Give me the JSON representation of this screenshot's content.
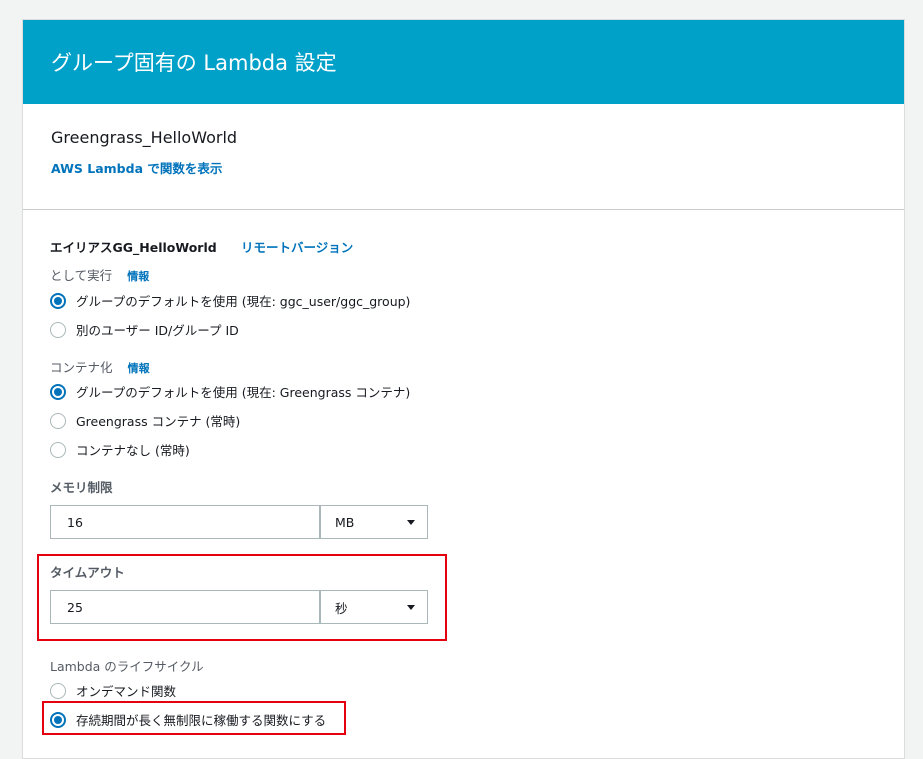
{
  "header": {
    "title": "グループ固有の Lambda 設定"
  },
  "function": {
    "name": "Greengrass_HelloWorld",
    "view_link": "AWS Lambda で関数を表示"
  },
  "alias": {
    "label": "エイリアスGG_HelloWorld",
    "remote_version_link": "リモートバージョン"
  },
  "run_as": {
    "label": "として実行",
    "info": "情報",
    "options": [
      {
        "label": "グループのデフォルトを使用 (現在: ggc_user/ggc_group)",
        "selected": true
      },
      {
        "label": "別のユーザー ID/グループ ID",
        "selected": false
      }
    ]
  },
  "containerization": {
    "label": "コンテナ化",
    "info": "情報",
    "options": [
      {
        "label": "グループのデフォルトを使用 (現在: Greengrass コンテナ)",
        "selected": true
      },
      {
        "label": "Greengrass コンテナ (常時)",
        "selected": false
      },
      {
        "label": "コンテナなし (常時)",
        "selected": false
      }
    ]
  },
  "memory_limit": {
    "label": "メモリ制限",
    "value": "16",
    "unit": "MB"
  },
  "timeout": {
    "label": "タイムアウト",
    "value": "25",
    "unit": "秒"
  },
  "lifecycle": {
    "label": "Lambda のライフサイクル",
    "options": [
      {
        "label": "オンデマンド関数",
        "selected": false
      },
      {
        "label": "存続期間が長く無制限に稼働する関数にする",
        "selected": true
      }
    ]
  },
  "colors": {
    "header_bg": "#00a1c9",
    "link": "#0073bb",
    "highlight": "#e4000f"
  }
}
